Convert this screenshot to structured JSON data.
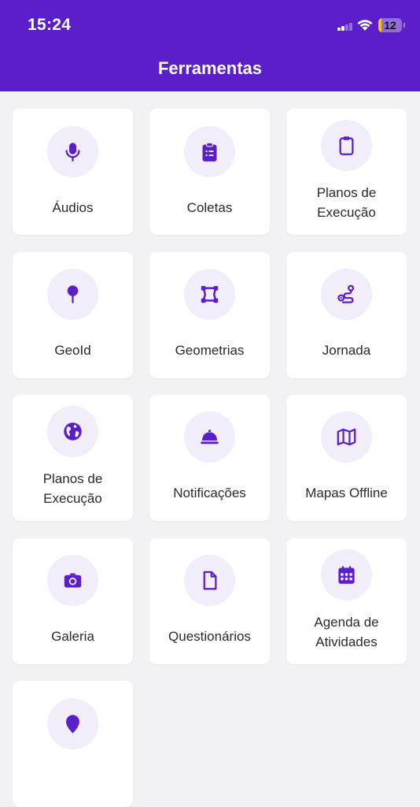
{
  "status_bar": {
    "time": "15:24",
    "battery_level": "12",
    "battery_color": "#f5c60a"
  },
  "header": {
    "title": "Ferramentas",
    "background_color": "#5a1fc8"
  },
  "accent_color": "#5a1fc8",
  "tools": [
    {
      "label": "Áudios",
      "icon": "microphone-icon"
    },
    {
      "label": "Coletas",
      "icon": "clipboard-list-icon"
    },
    {
      "label": "Planos de\nExecução",
      "icon": "clipboard-icon"
    },
    {
      "label": "GeoId",
      "icon": "map-pin-icon"
    },
    {
      "label": "Geometrias",
      "icon": "polygon-icon"
    },
    {
      "label": "Jornada",
      "icon": "route-icon"
    },
    {
      "label": "Planos de\nExecução",
      "icon": "globe-icon"
    },
    {
      "label": "Notificações",
      "icon": "bell-service-icon"
    },
    {
      "label": "Mapas Offline",
      "icon": "map-icon"
    },
    {
      "label": "Galeria",
      "icon": "camera-icon"
    },
    {
      "label": "Questionários",
      "icon": "document-icon"
    },
    {
      "label": "Agenda de\nAtividades",
      "icon": "calendar-icon"
    },
    {
      "label": "",
      "icon": "location-marker-icon"
    }
  ]
}
